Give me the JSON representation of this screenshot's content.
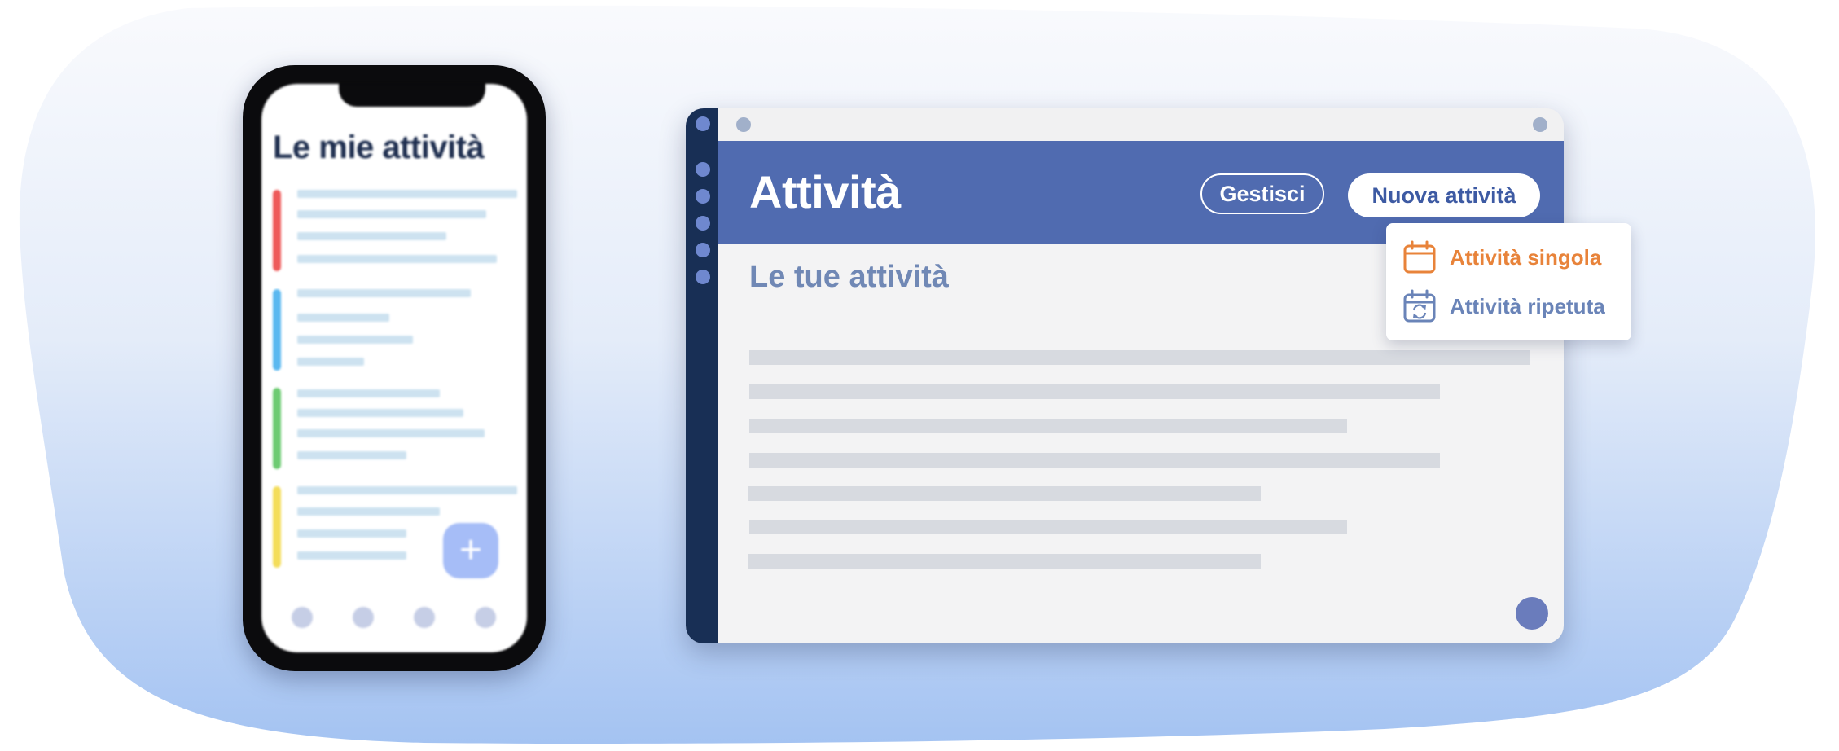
{
  "phone": {
    "title": "Le mie attività",
    "task_colors": [
      "#ee5a5a",
      "#5ab8f0",
      "#6dcb72",
      "#f4dd5a"
    ],
    "fab_icon": "plus-icon",
    "fab_symbol": "+",
    "nav_items": 4
  },
  "window": {
    "title": "Attività",
    "manage_button": "Gestisci",
    "new_button": "Nuova attività",
    "section_title": "Le tue attività"
  },
  "dropdown": {
    "items": [
      {
        "label": "Attività singola",
        "icon": "calendar-icon",
        "color": "#e8833a"
      },
      {
        "label": "Attività ripetuta",
        "icon": "calendar-repeat-icon",
        "color": "#6a84b8"
      }
    ]
  },
  "colors": {
    "header": "#506bb0",
    "sidebar": "#182f55",
    "accent_orange": "#e8833a"
  }
}
